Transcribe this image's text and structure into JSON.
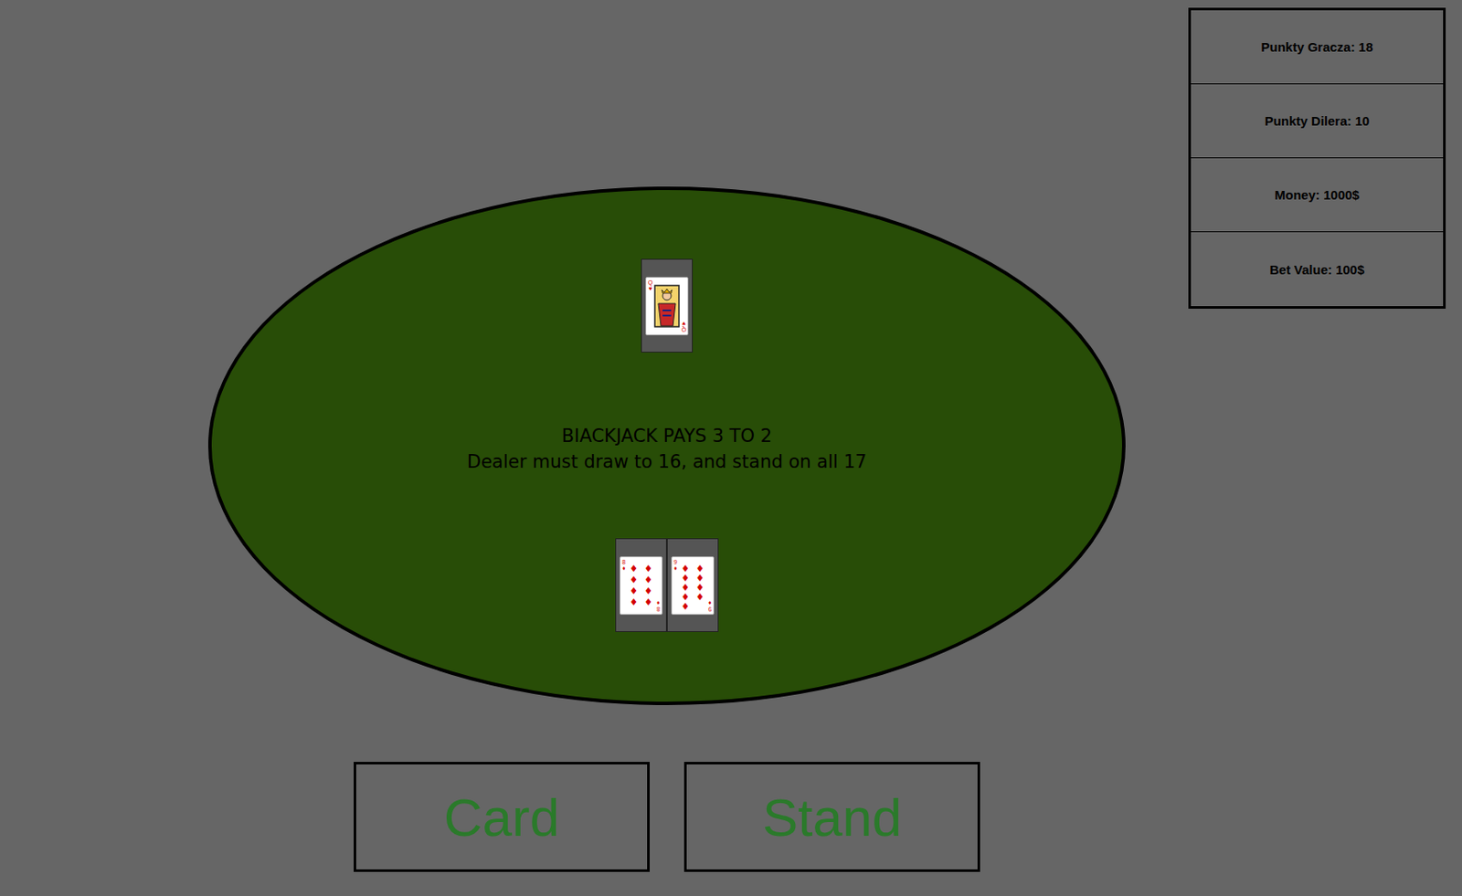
{
  "stats": [
    {
      "label": "Punkty Gracza: 18"
    },
    {
      "label": "Punkty Dilera: 10"
    },
    {
      "label": "Money: 1000$"
    },
    {
      "label": "Bet Value: 100$"
    }
  ],
  "table": {
    "lines": [
      "BIACKJACK PAYS 3 TO 2",
      "Dealer must draw to 16, and stand on all 17"
    ]
  },
  "dealer": {
    "cards": [
      {
        "rank": "Q",
        "suit": "♥"
      }
    ]
  },
  "player": {
    "cards": [
      {
        "rank": "8",
        "suit": "♦"
      },
      {
        "rank": "9",
        "suit": "♦"
      }
    ]
  },
  "buttons": [
    "Card",
    "Stand"
  ]
}
